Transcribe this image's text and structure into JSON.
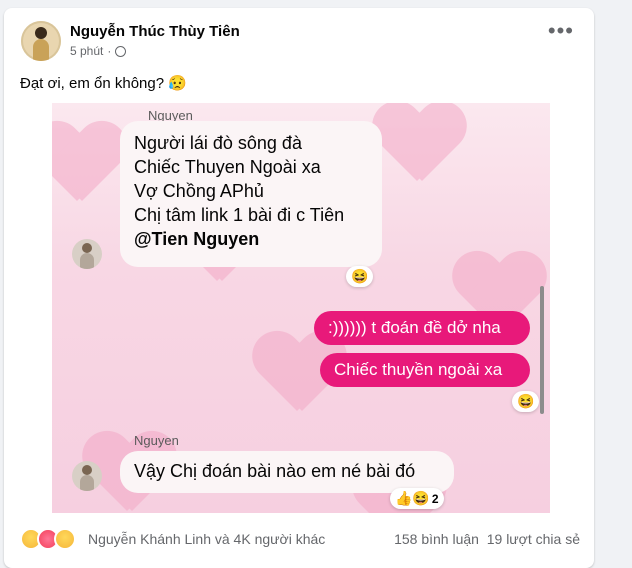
{
  "post": {
    "author": "Nguyễn Thúc Thùy Tiên",
    "time": "5 phút",
    "privacy_icon": "globe-icon",
    "more_icon": "more-options-icon",
    "caption": "Đạt ơi, em ổn không? 😥"
  },
  "chat": {
    "msg1": {
      "sender": "Nguyen",
      "lines": [
        "Người lái đò sông đà",
        "Chiếc Thuyen Ngoài xa",
        "Vợ Chồng APhủ",
        "Chị tâm link 1 bài đi c Tiên"
      ],
      "mention": "@Tien Nguyen",
      "reaction": "😆"
    },
    "out1": "‪:)))))) t đoán đề dở nha",
    "out2": "Chiếc thuyền ngoài xa",
    "out_reaction": "😆",
    "msg2": {
      "sender": "Nguyen",
      "text": "Vậy Chị đoán bài nào em né bài đó",
      "reactions": "👍😆",
      "reaction_count": "2"
    }
  },
  "footer": {
    "reactors": "Nguyễn Khánh Linh và 4K người khác",
    "comments": "158 bình luận",
    "shares": "19 lượt chia sẻ"
  }
}
